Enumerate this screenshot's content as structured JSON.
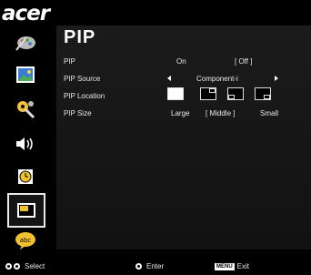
{
  "brand": "acer",
  "title": "PIP",
  "sidebar": {
    "items": [
      {
        "icon": "color-palette-icon"
      },
      {
        "icon": "image-icon"
      },
      {
        "icon": "settings-wrench-icon"
      },
      {
        "icon": "speaker-icon"
      },
      {
        "icon": "timer-icon"
      },
      {
        "icon": "pip-icon"
      },
      {
        "icon": "language-icon"
      }
    ],
    "active_index": 5
  },
  "menu": {
    "pip": {
      "label": "PIP",
      "on": "On",
      "off": "[ Off ]",
      "selected": "Off"
    },
    "source": {
      "label": "PIP Source",
      "value": "Component-i"
    },
    "location": {
      "label": "PIP Location",
      "options": [
        "top-left",
        "top-right",
        "bottom-left",
        "bottom-right"
      ],
      "selected": "top-left"
    },
    "size": {
      "label": "PIP Size",
      "large": "Large",
      "middle": "[ Middle ]",
      "small": "Small",
      "selected": "Middle"
    }
  },
  "footer": {
    "select": "Select",
    "enter": "Enter",
    "menu_key": "MENU",
    "exit": "Exit"
  },
  "colors": {
    "background": "#000000",
    "panel": "#161616",
    "text": "#ffffff"
  }
}
